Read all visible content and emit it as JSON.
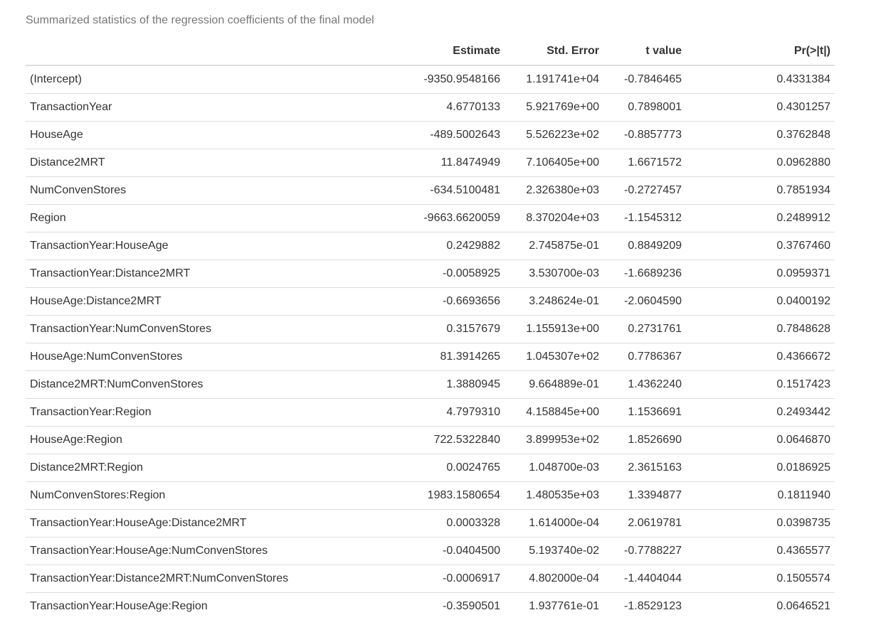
{
  "caption": "Summarized statistics of the regression coefficients of the final model",
  "table": {
    "headers": [
      "",
      "Estimate",
      "Std. Error",
      "t value",
      "Pr(>|t|)"
    ],
    "rows": [
      [
        "(Intercept)",
        "-9350.9548166",
        "1.191741e+04",
        "-0.7846465",
        "0.4331384"
      ],
      [
        "TransactionYear",
        "4.6770133",
        "5.921769e+00",
        "0.7898001",
        "0.4301257"
      ],
      [
        "HouseAge",
        "-489.5002643",
        "5.526223e+02",
        "-0.8857773",
        "0.3762848"
      ],
      [
        "Distance2MRT",
        "11.8474949",
        "7.106405e+00",
        "1.6671572",
        "0.0962880"
      ],
      [
        "NumConvenStores",
        "-634.5100481",
        "2.326380e+03",
        "-0.2727457",
        "0.7851934"
      ],
      [
        "Region",
        "-9663.6620059",
        "8.370204e+03",
        "-1.1545312",
        "0.2489912"
      ],
      [
        "TransactionYear:HouseAge",
        "0.2429882",
        "2.745875e-01",
        "0.8849209",
        "0.3767460"
      ],
      [
        "TransactionYear:Distance2MRT",
        "-0.0058925",
        "3.530700e-03",
        "-1.6689236",
        "0.0959371"
      ],
      [
        "HouseAge:Distance2MRT",
        "-0.6693656",
        "3.248624e-01",
        "-2.0604590",
        "0.0400192"
      ],
      [
        "TransactionYear:NumConvenStores",
        "0.3157679",
        "1.155913e+00",
        "0.2731761",
        "0.7848628"
      ],
      [
        "HouseAge:NumConvenStores",
        "81.3914265",
        "1.045307e+02",
        "0.7786367",
        "0.4366672"
      ],
      [
        "Distance2MRT:NumConvenStores",
        "1.3880945",
        "9.664889e-01",
        "1.4362240",
        "0.1517423"
      ],
      [
        "TransactionYear:Region",
        "4.7979310",
        "4.158845e+00",
        "1.1536691",
        "0.2493442"
      ],
      [
        "HouseAge:Region",
        "722.5322840",
        "3.899953e+02",
        "1.8526690",
        "0.0646870"
      ],
      [
        "Distance2MRT:Region",
        "0.0024765",
        "1.048700e-03",
        "2.3615163",
        "0.0186925"
      ],
      [
        "NumConvenStores:Region",
        "1983.1580654",
        "1.480535e+03",
        "1.3394877",
        "0.1811940"
      ],
      [
        "TransactionYear:HouseAge:Distance2MRT",
        "0.0003328",
        "1.614000e-04",
        "2.0619781",
        "0.0398735"
      ],
      [
        "TransactionYear:HouseAge:NumConvenStores",
        "-0.0404500",
        "5.193740e-02",
        "-0.7788227",
        "0.4365577"
      ],
      [
        "TransactionYear:Distance2MRT:NumConvenStores",
        "-0.0006917",
        "4.802000e-04",
        "-1.4404044",
        "0.1505574"
      ],
      [
        "TransactionYear:HouseAge:Region",
        "-0.3590501",
        "1.937761e-01",
        "-1.8529123",
        "0.0646521"
      ]
    ]
  }
}
